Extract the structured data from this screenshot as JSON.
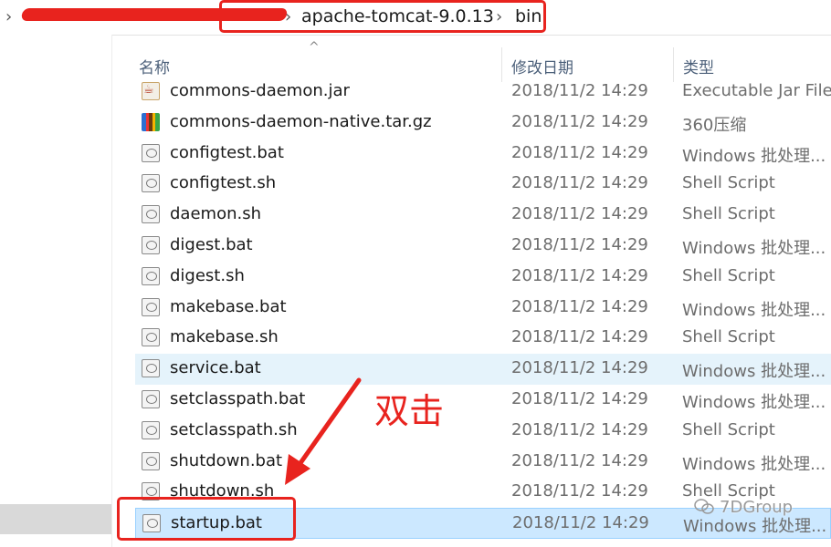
{
  "breadcrumb": {
    "segments": [
      "apache-tomcat-9.0.13",
      "bin"
    ]
  },
  "columns": {
    "name": "名称",
    "date": "修改日期",
    "type": "类型"
  },
  "files": [
    {
      "name": "commons-daemon.jar",
      "date": "2018/11/2 14:29",
      "type": "Executable Jar File",
      "icon": "jar-file-icon"
    },
    {
      "name": "commons-daemon-native.tar.gz",
      "date": "2018/11/2 14:29",
      "type": "360压缩",
      "icon": "archive-file-icon"
    },
    {
      "name": "configtest.bat",
      "date": "2018/11/2 14:29",
      "type": "Windows 批处理...",
      "icon": "batch-file-icon"
    },
    {
      "name": "configtest.sh",
      "date": "2018/11/2 14:29",
      "type": "Shell Script",
      "icon": "shell-script-icon"
    },
    {
      "name": "daemon.sh",
      "date": "2018/11/2 14:29",
      "type": "Shell Script",
      "icon": "shell-script-icon"
    },
    {
      "name": "digest.bat",
      "date": "2018/11/2 14:29",
      "type": "Windows 批处理...",
      "icon": "batch-file-icon"
    },
    {
      "name": "digest.sh",
      "date": "2018/11/2 14:29",
      "type": "Shell Script",
      "icon": "shell-script-icon"
    },
    {
      "name": "makebase.bat",
      "date": "2018/11/2 14:29",
      "type": "Windows 批处理...",
      "icon": "batch-file-icon"
    },
    {
      "name": "makebase.sh",
      "date": "2018/11/2 14:29",
      "type": "Shell Script",
      "icon": "shell-script-icon"
    },
    {
      "name": "service.bat",
      "date": "2018/11/2 14:29",
      "type": "Windows 批处理...",
      "icon": "batch-file-icon"
    },
    {
      "name": "setclasspath.bat",
      "date": "2018/11/2 14:29",
      "type": "Windows 批处理...",
      "icon": "batch-file-icon"
    },
    {
      "name": "setclasspath.sh",
      "date": "2018/11/2 14:29",
      "type": "Shell Script",
      "icon": "shell-script-icon"
    },
    {
      "name": "shutdown.bat",
      "date": "2018/11/2 14:29",
      "type": "Windows 批处理...",
      "icon": "batch-file-icon"
    },
    {
      "name": "shutdown.sh",
      "date": "2018/11/2 14:29",
      "type": "Shell Script",
      "icon": "shell-script-icon"
    },
    {
      "name": "startup.bat",
      "date": "2018/11/2 14:29",
      "type": "Windows 批处理...",
      "icon": "batch-file-icon"
    }
  ],
  "highlighted_file": "service.bat",
  "selected_file": "startup.bat",
  "annotation": {
    "text": "双击",
    "color": "#e8231e"
  },
  "watermark": "7DGroup"
}
